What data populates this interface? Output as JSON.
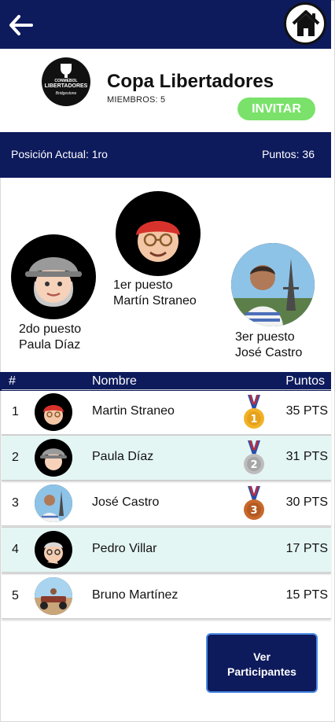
{
  "group": {
    "name": "Copa Libertadores",
    "members": "MIEMBROS: 5",
    "invite_label": "INVITAR",
    "logo_text": {
      "line1": "CONMEBOL",
      "line2": "LIBERTADORES",
      "line3": "Bridgestone"
    }
  },
  "stats": {
    "position": "Posición Actual: 1ro",
    "points": "Puntos: 36"
  },
  "podium": {
    "first": {
      "place": "1er puesto",
      "name": "Martín Straneo"
    },
    "second": {
      "place": "2do puesto",
      "name": "Paula Díaz"
    },
    "third": {
      "place": "3er puesto",
      "name": "José Castro"
    }
  },
  "table": {
    "headers": {
      "rank": "#",
      "name": "Nombre",
      "points": "Puntos"
    },
    "rows": [
      {
        "rank": "1",
        "name": "Martin Straneo",
        "points": "35 PTS",
        "medal": "gold-medal-icon",
        "medal_number": "1"
      },
      {
        "rank": "2",
        "name": "Paula Díaz",
        "points": "31 PTS",
        "medal": "silver-medal-icon",
        "medal_number": "2"
      },
      {
        "rank": "3",
        "name": "José Castro",
        "points": "30 PTS",
        "medal": "bronze-medal-icon",
        "medal_number": "3"
      },
      {
        "rank": "4",
        "name": "Pedro Villar",
        "points": "17 PTS"
      },
      {
        "rank": "5",
        "name": "Bruno Martínez",
        "points": "15 PTS"
      }
    ]
  },
  "actions": {
    "participants_line1": "Ver",
    "participants_line2": "Participantes"
  },
  "colors": {
    "navy": "#0d1a5c",
    "invite_green": "#7ae26a",
    "row_highlight": "#e4f6f4",
    "button_border": "#4a8be6"
  },
  "icons": {
    "back": "arrow-left-icon",
    "home": "home-icon"
  }
}
